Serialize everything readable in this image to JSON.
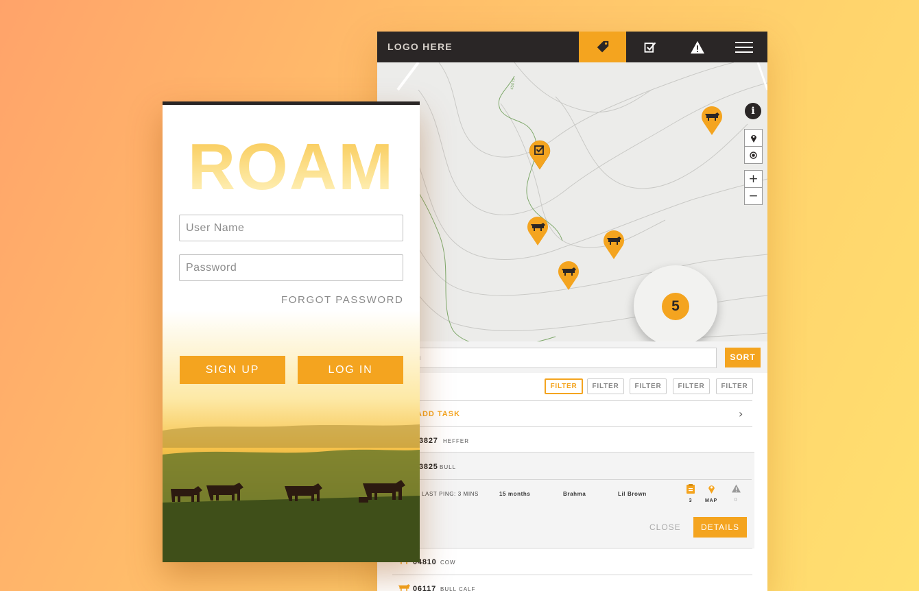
{
  "tablet": {
    "logo": "LOGO HERE",
    "nav": [
      {
        "icon": "tag-icon",
        "active": true
      },
      {
        "icon": "checkbox-icon",
        "active": false
      },
      {
        "icon": "warning-icon",
        "active": false
      },
      {
        "icon": "hamburger-menu-icon",
        "active": false
      }
    ],
    "map": {
      "cluster_count": "5",
      "contour_label": "450 m",
      "controls": [
        "location-pin-icon",
        "locate-me-icon",
        "+",
        "−"
      ],
      "info": "i"
    },
    "search": {
      "placeholder_visible": "rch",
      "sort_label": "SORT"
    },
    "list": {
      "tasks_label_visible": "S",
      "filters": [
        "FILTER",
        "FILTER",
        "FILTER",
        "FILTER",
        "FILTER"
      ],
      "add_task": "ADD TASK",
      "rows": [
        {
          "num": "3827",
          "kind": "HEFFER"
        },
        {
          "num": "3825",
          "kind": "BULL"
        },
        {
          "num": "04810",
          "kind": "COW"
        },
        {
          "num": "06117",
          "kind": "BULL CALF"
        }
      ],
      "expanded": {
        "last_ping": "LAST PING: 3 MINS",
        "age": "15 months",
        "breed": "Brahma",
        "name": "Lil Brown",
        "tasks_count": "3",
        "map_label": "MAP",
        "alerts_count": "0",
        "close": "CLOSE",
        "details": "DETAILS"
      }
    }
  },
  "phone": {
    "brand": "ROAM",
    "username_placeholder": "User Name",
    "password_placeholder": "Password",
    "forgot": "FORGOT PASSWORD",
    "signup": "SIGN UP",
    "login": "LOG IN"
  },
  "colors": {
    "accent": "#f4a41f",
    "dark": "#2a2626",
    "map_bg": "#ececea"
  }
}
